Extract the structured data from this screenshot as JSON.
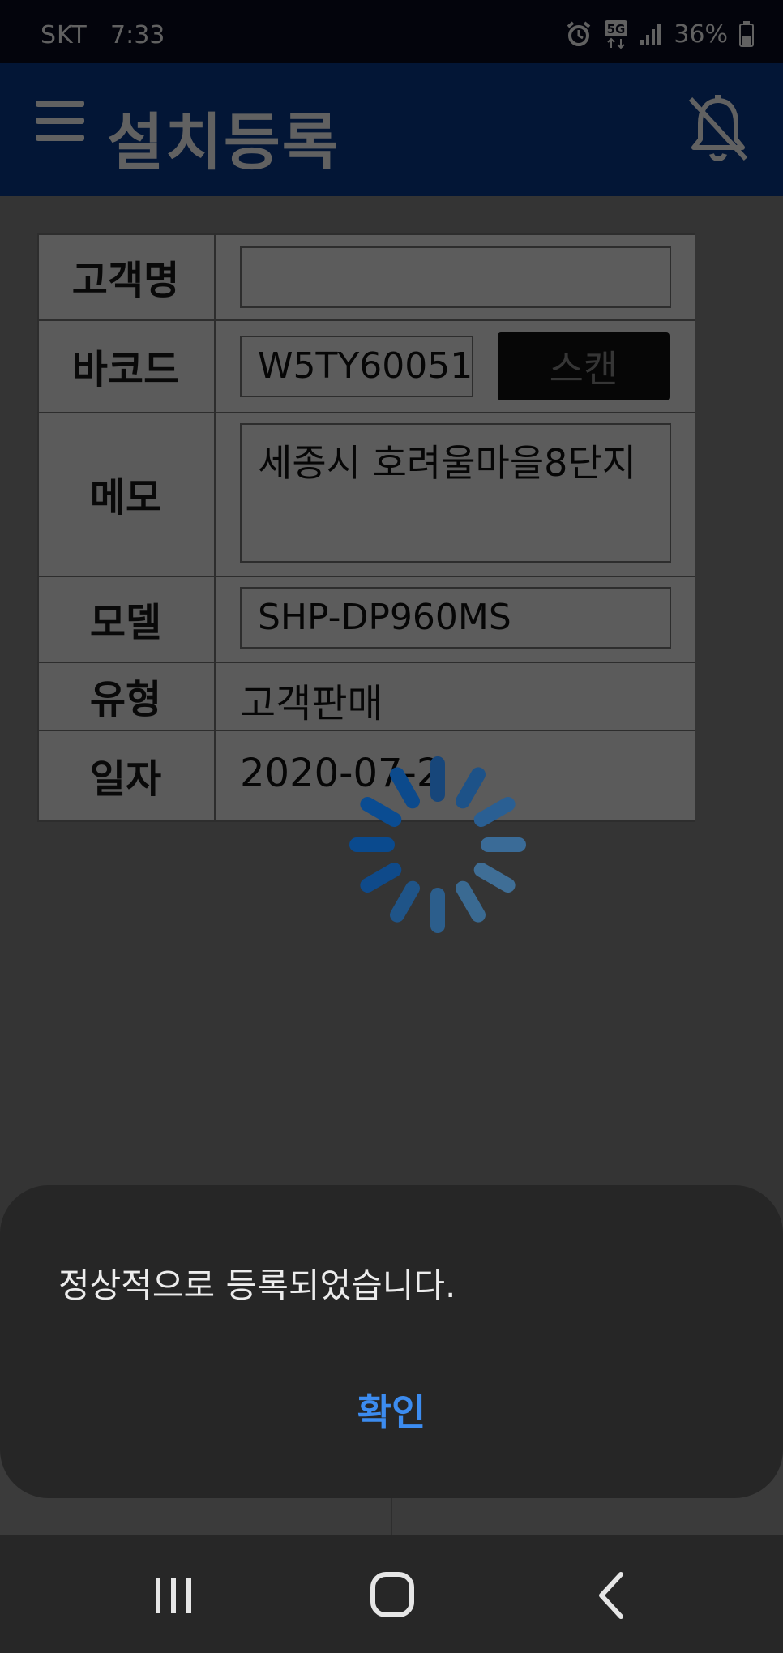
{
  "status_bar": {
    "carrier": "SKT",
    "time": "7:33",
    "battery": "36%",
    "icons": [
      "alarm-icon",
      "5g-icon",
      "signal-icon",
      "battery-icon"
    ]
  },
  "app_bar": {
    "title": "설치등록",
    "icons": [
      "menu-icon",
      "bell-off-icon"
    ]
  },
  "form": {
    "customer_label": "고객명",
    "customer_value": "",
    "barcode_label": "바코드",
    "barcode_value": "W5TY60051",
    "scan_label": "스캔",
    "memo_label": "메모",
    "memo_value": "세종시 호려울마을8단지",
    "model_label": "모델",
    "model_value": "SHP-DP960MS",
    "type_label": "유형",
    "type_value": "고객판매",
    "date_label": "일자",
    "date_value": "2020-07-2"
  },
  "dialog": {
    "message": "정상적으로 등록되었습니다.",
    "confirm_label": "확인"
  },
  "nav_bar": {
    "icons": [
      "recent-apps-icon",
      "home-icon",
      "back-icon"
    ]
  },
  "colors": {
    "app_bar": "#0a3a8e",
    "accent": "#3c8cf0",
    "dialog_bg": "#262626"
  }
}
